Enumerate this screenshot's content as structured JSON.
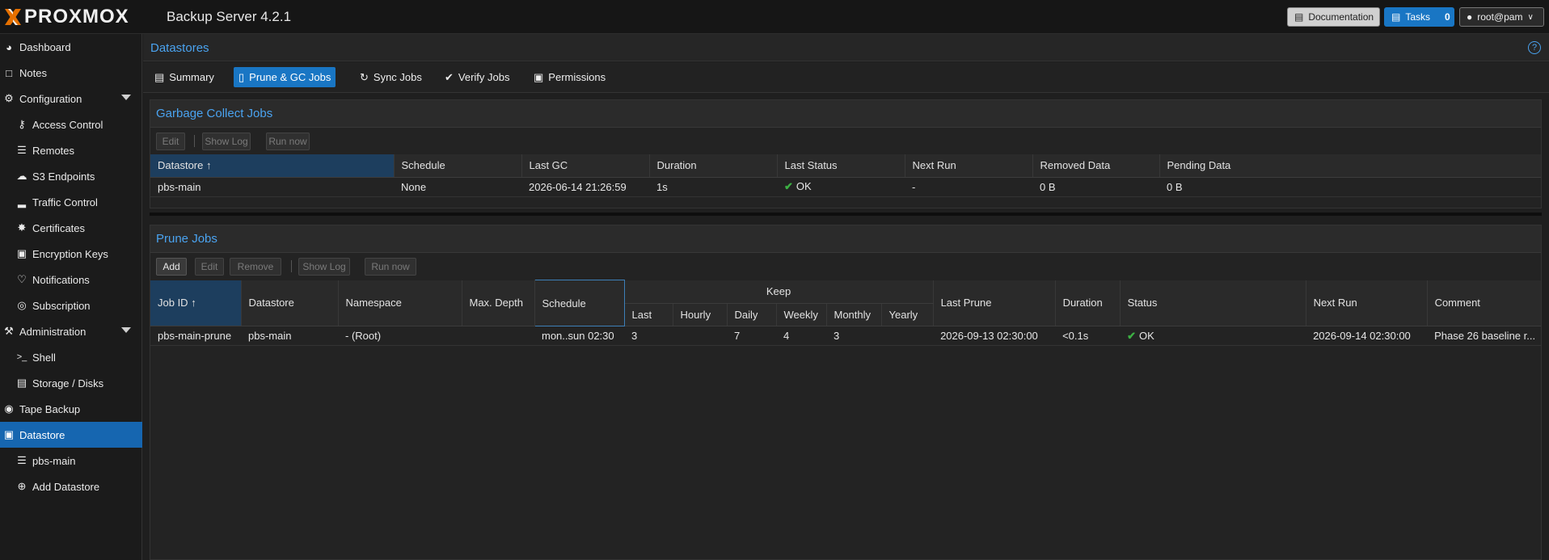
{
  "header": {
    "brand_x": "X",
    "brand_text": "PROXMOX",
    "version": "Backup Server 4.2.1",
    "documentation_label": "Documentation",
    "tasks_label": "Tasks",
    "tasks_count": "0",
    "user_label": "root@pam"
  },
  "sidebar": {
    "items": [
      {
        "label": "Dashboard",
        "icon": "dashboard-icon"
      },
      {
        "label": "Notes",
        "icon": "notes-icon"
      },
      {
        "label": "Configuration",
        "icon": "cogs-icon"
      },
      {
        "label": "Access Control",
        "icon": "key-icon"
      },
      {
        "label": "Remotes",
        "icon": "server-icon"
      },
      {
        "label": "S3 Endpoints",
        "icon": "cloud-icon"
      },
      {
        "label": "Traffic Control",
        "icon": "signal-icon"
      },
      {
        "label": "Certificates",
        "icon": "certificate-icon"
      },
      {
        "label": "Encryption Keys",
        "icon": "lock-icon"
      },
      {
        "label": "Notifications",
        "icon": "bell-icon"
      },
      {
        "label": "Subscription",
        "icon": "support-icon"
      },
      {
        "label": "Administration",
        "icon": "wrench-icon"
      },
      {
        "label": "Shell",
        "icon": "terminal-icon"
      },
      {
        "label": "Storage / Disks",
        "icon": "disk-icon"
      },
      {
        "label": "Tape Backup",
        "icon": "tape-icon"
      },
      {
        "label": "Datastore",
        "icon": "archive-icon"
      },
      {
        "label": "pbs-main",
        "icon": "database-icon"
      },
      {
        "label": "Add Datastore",
        "icon": "plus-circle-icon"
      }
    ]
  },
  "main": {
    "title": "Datastores",
    "help": "?",
    "tabs": [
      {
        "label": "Summary",
        "icon": "book-icon"
      },
      {
        "label": "Prune & GC Jobs",
        "icon": "trash-icon"
      },
      {
        "label": "Sync Jobs",
        "icon": "refresh-icon"
      },
      {
        "label": "Verify Jobs",
        "icon": "check-circle-icon"
      },
      {
        "label": "Permissions",
        "icon": "unlock-icon"
      }
    ]
  },
  "gc": {
    "title": "Garbage Collect Jobs",
    "toolbar": {
      "edit": "Edit",
      "show_log": "Show Log",
      "run_now": "Run now"
    },
    "columns": [
      "Datastore",
      "Schedule",
      "Last GC",
      "Duration",
      "Last Status",
      "Next Run",
      "Removed Data",
      "Pending Data"
    ],
    "sort_arrow": "↑",
    "rows": [
      {
        "datastore": "pbs-main",
        "schedule": "None",
        "last_gc": "2026-06-14 21:26:59",
        "duration": "1s",
        "last_status": "OK",
        "next_run": "-",
        "removed": "0 B",
        "pending": "0 B"
      }
    ]
  },
  "prune": {
    "title": "Prune Jobs",
    "toolbar": {
      "add": "Add",
      "edit": "Edit",
      "remove": "Remove",
      "show_log": "Show Log",
      "run_now": "Run now"
    },
    "columns": {
      "job_id": "Job ID",
      "datastore": "Datastore",
      "namespace": "Namespace",
      "max_depth": "Max. Depth",
      "schedule": "Schedule",
      "keep": "Keep",
      "keep_sub": [
        "Last",
        "Hourly",
        "Daily",
        "Weekly",
        "Monthly",
        "Yearly"
      ],
      "last_prune": "Last Prune",
      "duration": "Duration",
      "status": "Status",
      "next_run": "Next Run",
      "comment": "Comment"
    },
    "sort_arrow": "↑",
    "rows": [
      {
        "job_id": "pbs-main-prune",
        "datastore": "pbs-main",
        "namespace": "- (Root)",
        "max_depth": "",
        "schedule": "mon..sun 02:30",
        "last": "3",
        "hourly": "",
        "daily": "7",
        "weekly": "4",
        "monthly": "3",
        "yearly": "",
        "last_prune": "2026-09-13 02:30:00",
        "duration": "<0.1s",
        "status": "OK",
        "next_run": "2026-09-14 02:30:00",
        "comment": "Phase 26 baseline r..."
      }
    ]
  },
  "colors": {
    "accent": "#1976c4",
    "title_blue": "#4aa3f0",
    "ok_green": "#3cb043",
    "brand_orange": "#e57000"
  }
}
